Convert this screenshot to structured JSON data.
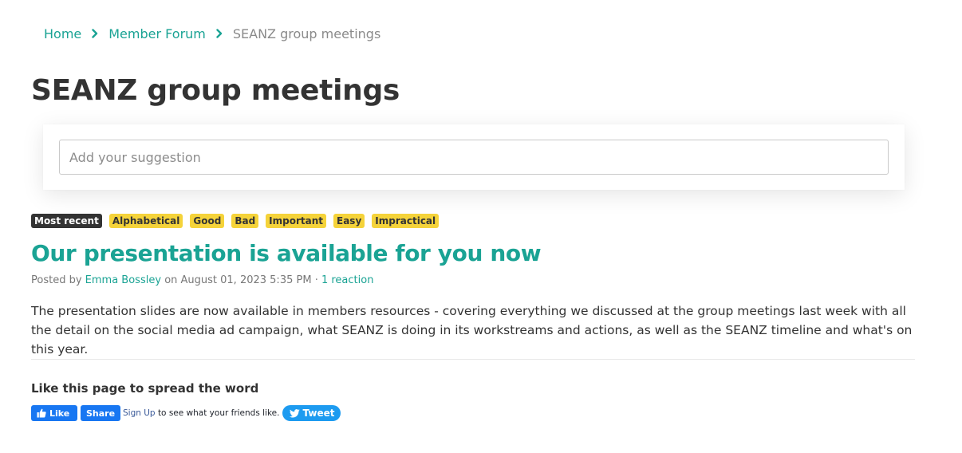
{
  "breadcrumb": {
    "home": "Home",
    "forum": "Member Forum",
    "current": "SEANZ group meetings"
  },
  "page_title": "SEANZ group meetings",
  "suggestion": {
    "placeholder": "Add your suggestion",
    "value": ""
  },
  "tags": [
    {
      "label": "Most recent",
      "active": true
    },
    {
      "label": "Alphabetical",
      "active": false
    },
    {
      "label": "Good",
      "active": false
    },
    {
      "label": "Bad",
      "active": false
    },
    {
      "label": "Important",
      "active": false
    },
    {
      "label": "Easy",
      "active": false
    },
    {
      "label": "Impractical",
      "active": false
    }
  ],
  "post": {
    "title": "Our presentation is available for you now",
    "posted_by_prefix": "Posted by",
    "author": "Emma Bossley",
    "date_text": "on August 01, 2023 5:35 PM",
    "separator": "·",
    "reactions": "1 reaction",
    "body": "The presentation slides are now available in members resources - covering everything we discussed at the group meetings last week with all the detail on the social media ad campaign, what SEANZ is doing in its workstreams and actions, as well as the SEANZ timeline and what's on this year."
  },
  "share": {
    "heading": "Like this page to spread the word",
    "like_label": "Like",
    "share_label": "Share",
    "signup_link": "Sign Up",
    "signup_text": "to see what your friends like.",
    "tweet_label": "Tweet"
  },
  "colors": {
    "accent": "#1aa394",
    "tag_yellow": "#f5d33a",
    "tag_active": "#333333",
    "facebook": "#1877f2",
    "twitter": "#1d9bf0"
  },
  "icons": [
    "chevron-right-icon",
    "thumbs-up-icon",
    "twitter-bird-icon"
  ]
}
